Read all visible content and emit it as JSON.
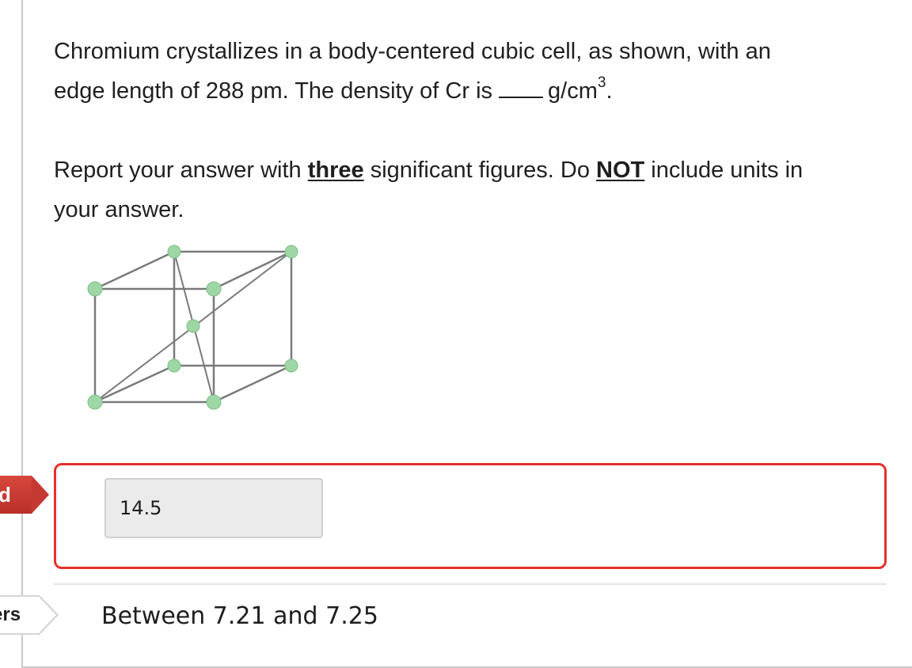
{
  "question": {
    "line1": "Chromium crystallizes in a body-centered cubic cell, as shown, with an",
    "line2_before_blank": "edge length of 288 pm. The density of Cr is",
    "line2_unit": "g/cm",
    "line2_unit_exponent": "3",
    "line2_end": ".",
    "instr_a": "Report your answer with ",
    "instr_emphasis1": "three",
    "instr_b": " significant figures. Do ",
    "instr_emphasis2": "NOT",
    "instr_c": " include units in",
    "instr_line2": "your answer."
  },
  "diagram": {
    "atom_color": "#9fd6a5",
    "edge_color": "#7a7a7a"
  },
  "status_tabs": {
    "submitted_label": "d",
    "submitted_color": "#c43a32",
    "answers_label": "ers"
  },
  "answer": {
    "value": "14.5",
    "border_color": "#e2322b"
  },
  "correct_answer": {
    "text": "Between 7.21 and 7.25"
  }
}
